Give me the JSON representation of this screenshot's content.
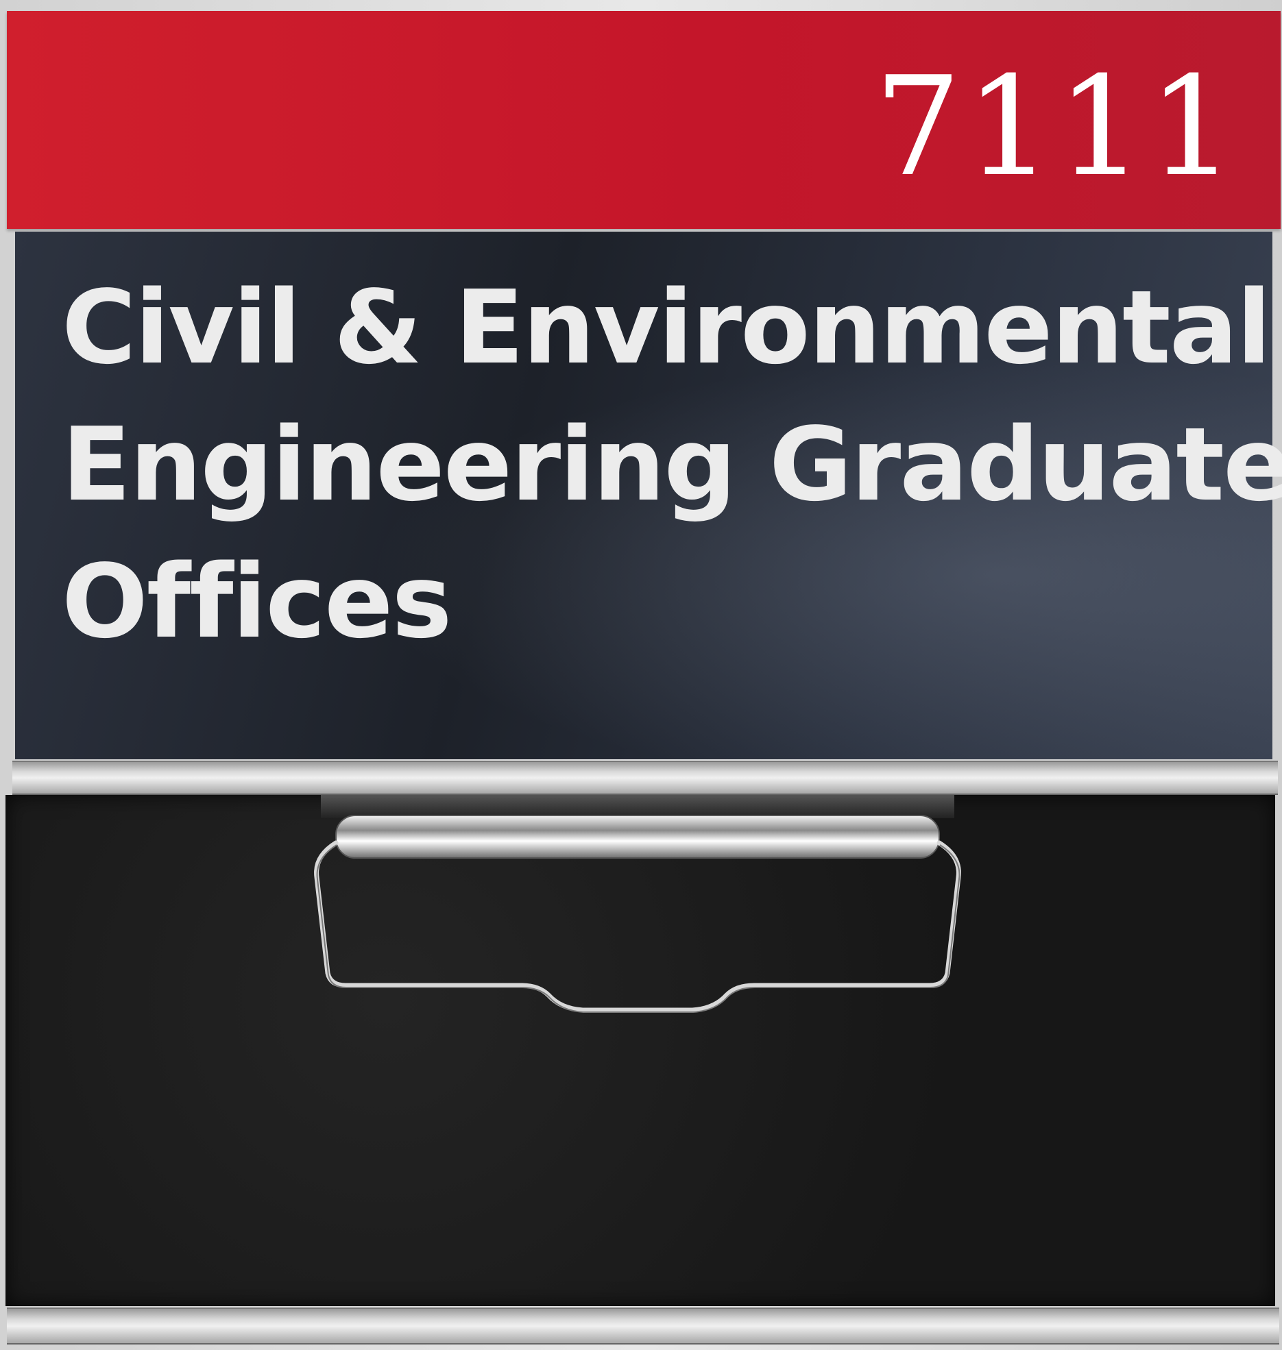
{
  "sign": {
    "room_number": "7111",
    "department_lines": [
      "Civil & Environmental",
      "Engineering Graduate",
      "Offices"
    ],
    "colors": {
      "room_band": "#c4162a",
      "name_panel": "#1d2129",
      "lettering": "#ececec",
      "felt_insert": "#171717"
    },
    "hardware": {
      "clip_icon": "wire-clip-icon"
    }
  }
}
